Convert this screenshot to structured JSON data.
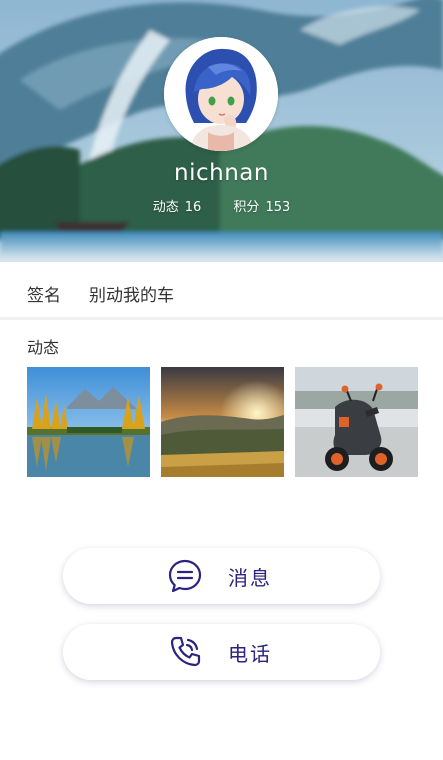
{
  "profile": {
    "username": "nichnan",
    "stats": [
      {
        "label": "动态",
        "value": "16"
      },
      {
        "label": "积分",
        "value": "153"
      }
    ]
  },
  "signature": {
    "label": "签名",
    "value": "别动我的车"
  },
  "feed": {
    "title": "动态",
    "images": [
      {
        "name": "autumn-lake-photo"
      },
      {
        "name": "mountain-sunset-photo"
      },
      {
        "name": "electric-scooter-photo"
      }
    ]
  },
  "actions": {
    "message_label": "消息",
    "phone_label": "电话"
  },
  "colors": {
    "accent": "#2a2380",
    "cover_sky": "#7ea9c9",
    "cover_sea": "#3f85b0",
    "divider": "#f0f0f0"
  },
  "icons": {
    "message": "chat-bubble-icon",
    "phone": "phone-ringing-icon"
  }
}
